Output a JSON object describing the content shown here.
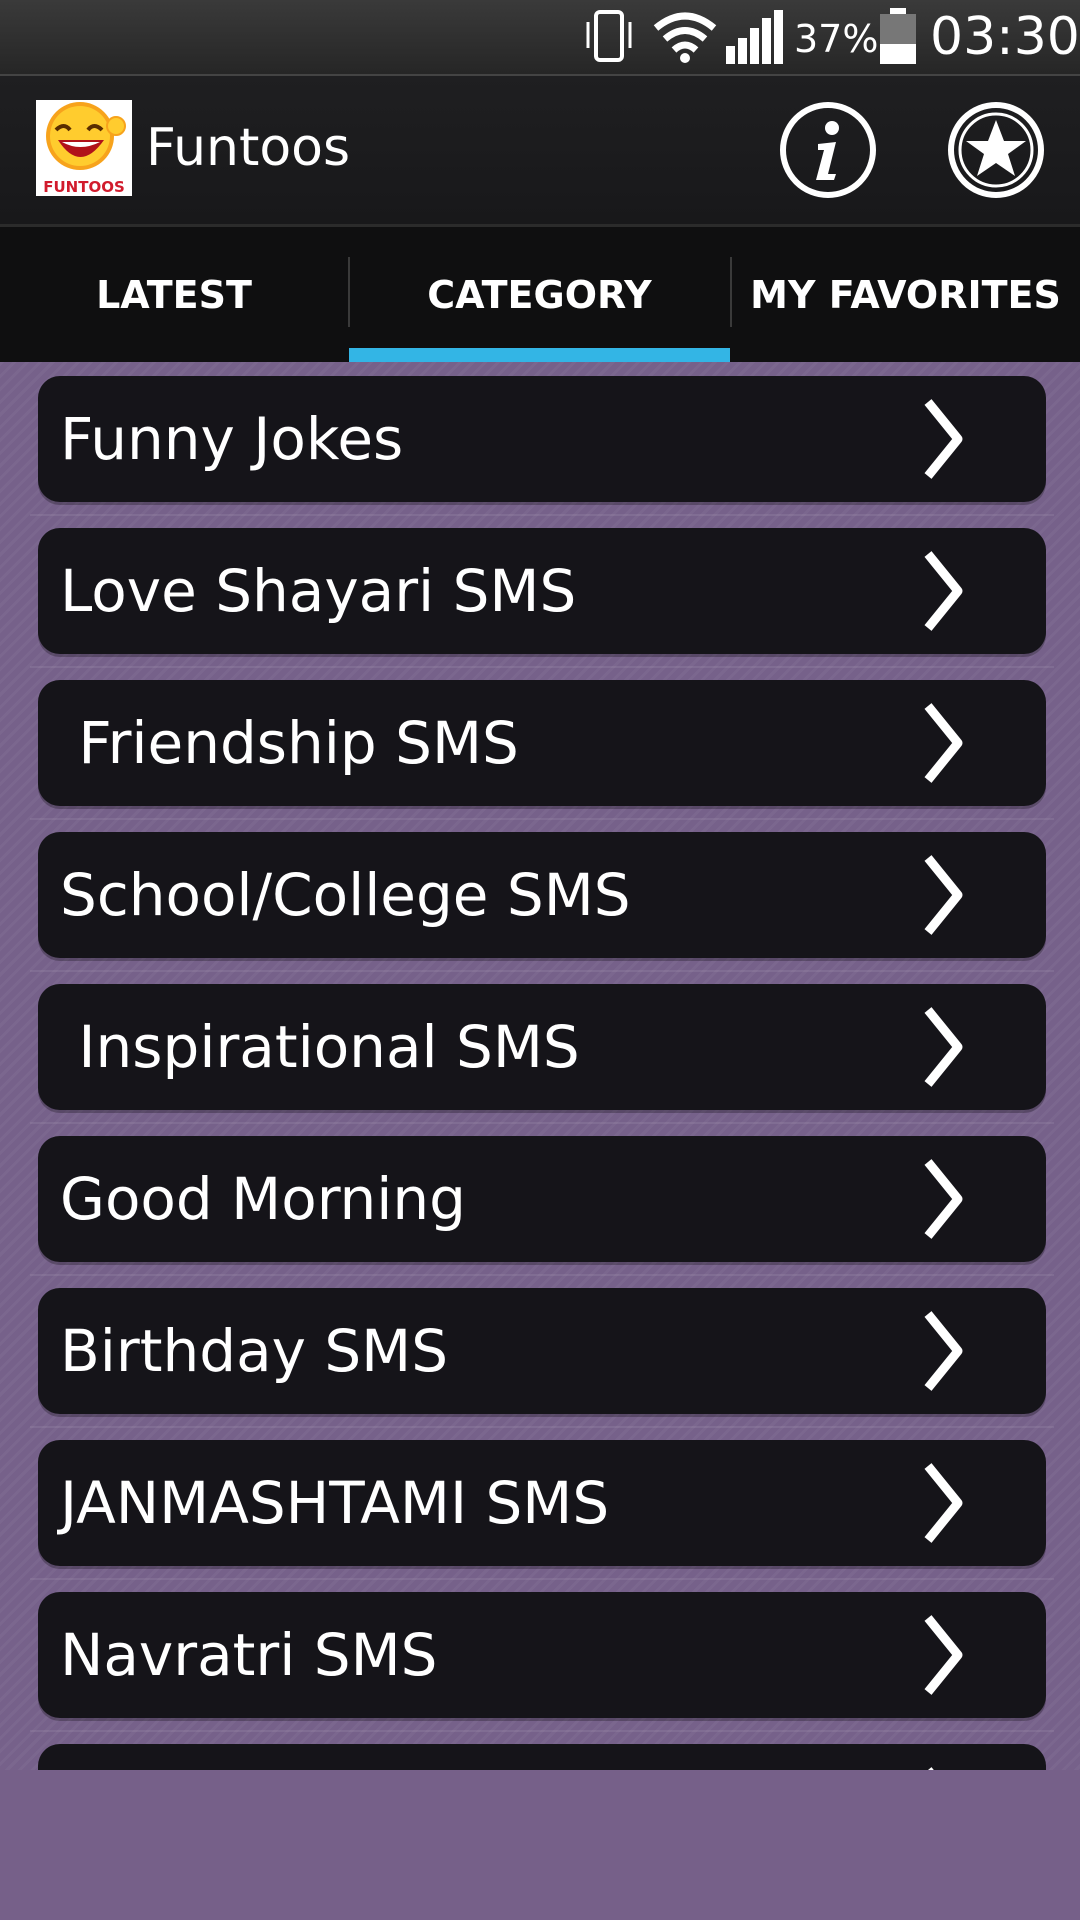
{
  "status_bar": {
    "battery_percent": "37%",
    "time": "03:30"
  },
  "app_bar": {
    "title": "Funtoos",
    "logo_text": "FUNTOOS"
  },
  "tabs": [
    {
      "label": "LATEST",
      "selected": false
    },
    {
      "label": "CATEGORY",
      "selected": true
    },
    {
      "label": "MY FAVORITES",
      "selected": false
    }
  ],
  "categories": [
    {
      "label": "Funny Jokes"
    },
    {
      "label": "Love Shayari SMS"
    },
    {
      "label": " Friendship SMS"
    },
    {
      "label": "School/College SMS"
    },
    {
      "label": " Inspirational SMS"
    },
    {
      "label": "Good Morning"
    },
    {
      "label": "Birthday SMS"
    },
    {
      "label": "JANMASHTAMI SMS"
    },
    {
      "label": "Navratri SMS"
    },
    {
      "label": ""
    }
  ],
  "colors": {
    "accent": "#33b5e5",
    "background": "#766089",
    "item_background": "#151419"
  },
  "icons": {
    "vibrate": "vibrate-icon",
    "wifi": "wifi-icon",
    "signal": "signal-icon",
    "battery": "battery-icon",
    "info": "info-icon",
    "favorite": "star-icon",
    "chevron": "chevron-right-icon"
  }
}
